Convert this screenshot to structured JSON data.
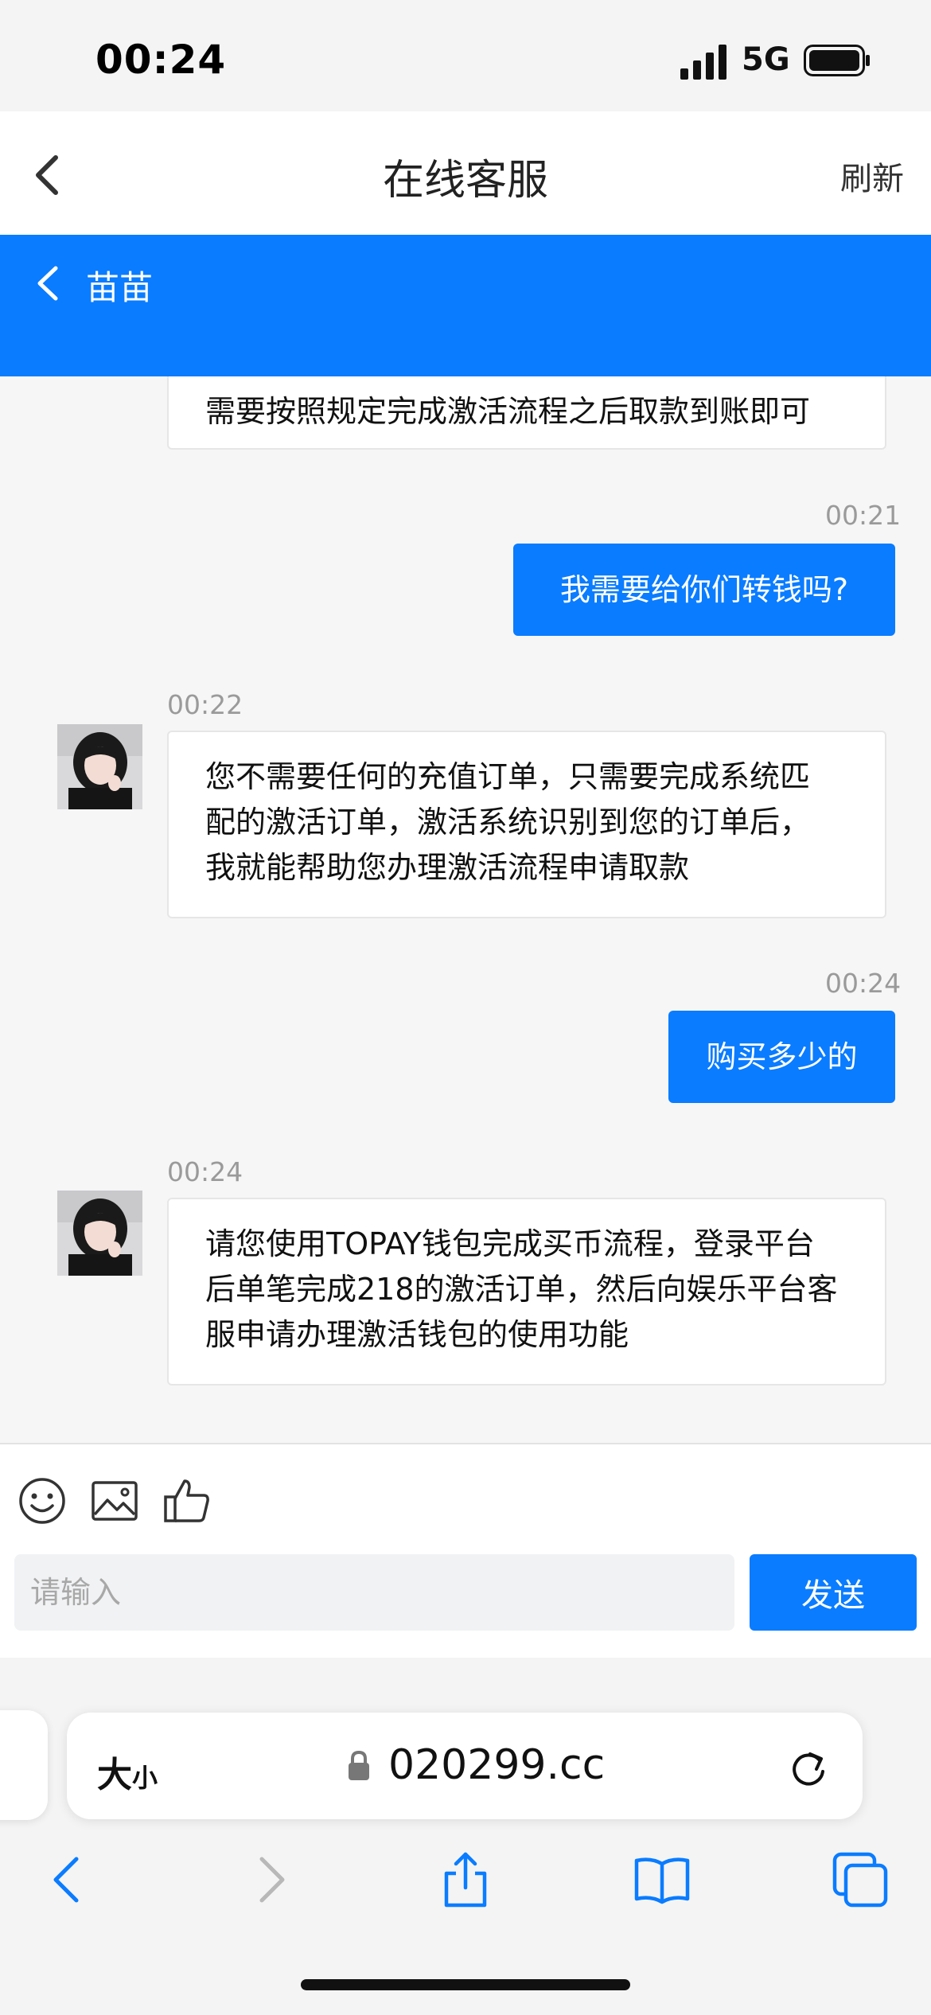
{
  "status_bar": {
    "time": "00:24",
    "network": "5G"
  },
  "nav": {
    "title": "在线客服",
    "refresh_label": "刷新"
  },
  "agent": {
    "name": "苗苗"
  },
  "messages": [
    {
      "from": "agent",
      "time": "",
      "text": "需要按照规定完成激活流程之后取款到账即可"
    },
    {
      "from": "user",
      "time": "00:21",
      "text": "我需要给你们转钱吗?"
    },
    {
      "from": "agent",
      "time": "00:22",
      "lines": [
        "您不需要任何的充值订单，只需要完成系统匹",
        "配的激活订单，激活系统识别到您的订单后，",
        "我就能帮助您办理激活流程申请取款"
      ]
    },
    {
      "from": "user",
      "time": "00:24",
      "text": "购买多少的"
    },
    {
      "from": "agent",
      "time": "00:24",
      "lines": [
        "请您使用TOPAY钱包完成买币流程，登录平台",
        "后单笔完成218的激活订单，然后向娱乐平台客",
        "服申请办理激活钱包的使用功能"
      ]
    }
  ],
  "composer": {
    "placeholder": "请输入",
    "send_label": "发送"
  },
  "browser": {
    "text_size_big": "大",
    "text_size_small": "小",
    "url": "020299.cc"
  },
  "colors": {
    "accent": "#0a7cff",
    "page_bg": "#f6f6f6"
  },
  "icons": [
    "signal-icon",
    "battery-icon",
    "back-icon",
    "emoji-icon",
    "image-icon",
    "thumbs-up-icon",
    "lock-icon",
    "reload-icon",
    "safari-back-icon",
    "safari-forward-icon",
    "share-icon",
    "bookmarks-icon",
    "tabs-icon"
  ]
}
